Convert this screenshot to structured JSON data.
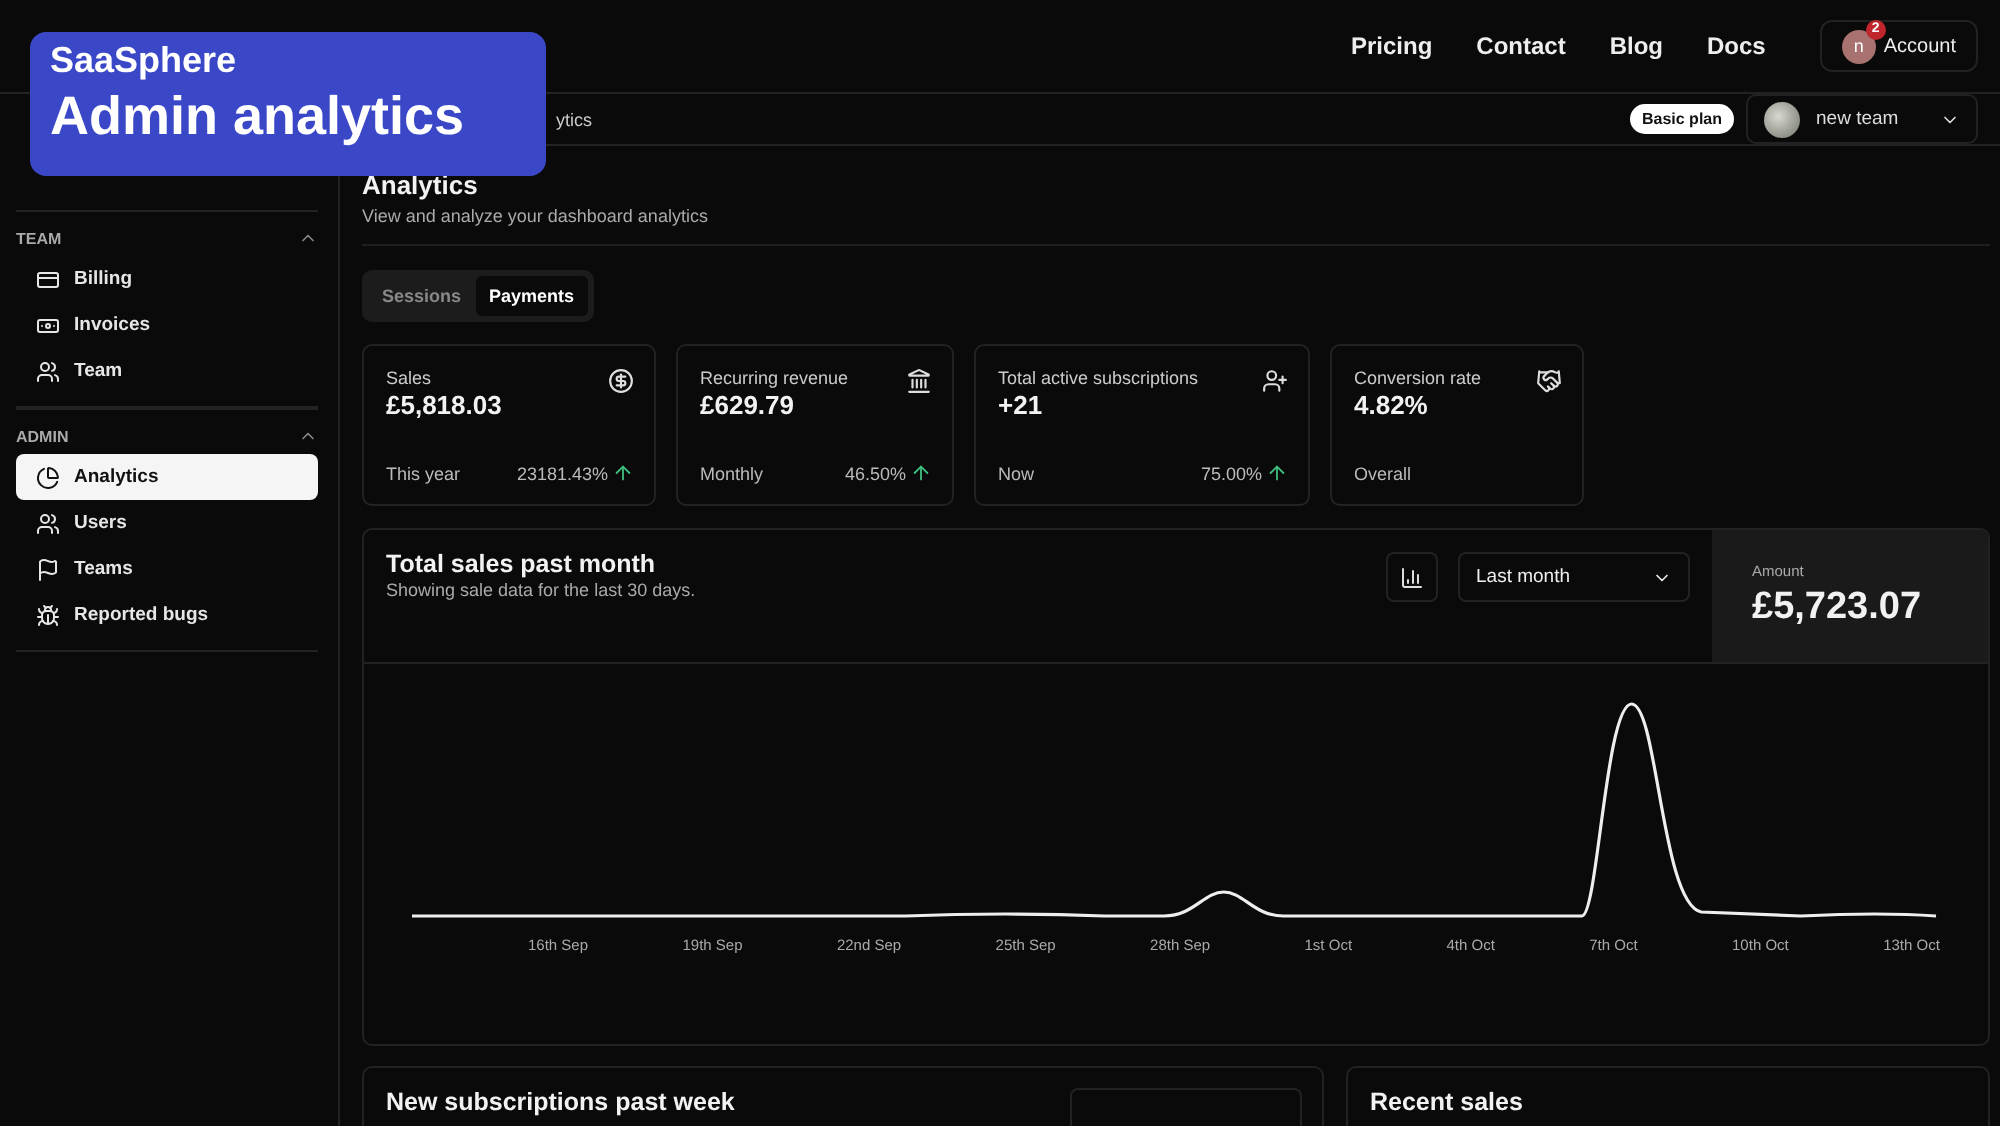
{
  "overlay": {
    "brand": "SaaSphere",
    "title": "Admin analytics"
  },
  "nav": {
    "links": [
      "Pricing",
      "Contact",
      "Blog",
      "Docs"
    ],
    "account": {
      "initial": "n",
      "badge": "2",
      "label": "Account"
    }
  },
  "breadcrumb": "ytics",
  "plan_badge": "Basic plan",
  "team_select": {
    "label": "new team"
  },
  "sidebar": {
    "sections": [
      {
        "label": "TEAM",
        "expanded": true,
        "items": [
          {
            "kind": "billing",
            "label": "Billing",
            "selected": false
          },
          {
            "kind": "invoices",
            "label": "Invoices",
            "selected": false
          },
          {
            "kind": "team",
            "label": "Team",
            "selected": false
          }
        ]
      },
      {
        "label": "ADMIN",
        "expanded": true,
        "items": [
          {
            "kind": "analytics",
            "label": "Analytics",
            "selected": true
          },
          {
            "kind": "users",
            "label": "Users",
            "selected": false
          },
          {
            "kind": "teams",
            "label": "Teams",
            "selected": false
          },
          {
            "kind": "bugs",
            "label": "Reported bugs",
            "selected": false
          }
        ]
      }
    ]
  },
  "page": {
    "title": "Analytics",
    "subtitle": "View and analyze your dashboard analytics"
  },
  "tabs": [
    {
      "label": "Sessions",
      "selected": false
    },
    {
      "label": "Payments",
      "selected": true
    }
  ],
  "stats": [
    {
      "kind": "coin",
      "label": "Sales",
      "value": "£5,818.03",
      "period": "This year",
      "change": "23181.43%"
    },
    {
      "kind": "bank",
      "label": "Recurring revenue",
      "value": "£629.79",
      "period": "Monthly",
      "change": "46.50%"
    },
    {
      "kind": "user-plus",
      "label": "Total active subscriptions",
      "value": "+21",
      "period": "Now",
      "change": "75.00%"
    },
    {
      "kind": "handshake",
      "label": "Conversion rate",
      "value": "4.82%",
      "period": "Overall"
    }
  ],
  "sales_chart": {
    "title": "Total sales past month",
    "subtitle": "Showing sale data for the last 30 days.",
    "range": "Last month",
    "amount_label": "Amount",
    "amount": "£5,723.07",
    "x_labels": [
      "16th Sep",
      "19th Sep",
      "22nd Sep",
      "25th Sep",
      "28th Sep",
      "1st Oct",
      "4th Oct",
      "7th Oct",
      "10th Oct",
      "13th Oct"
    ]
  },
  "bottom_cards": [
    {
      "kind": "select",
      "title": "New subscriptions past week"
    },
    {
      "kind": "plain",
      "title": "Recent sales"
    }
  ]
}
